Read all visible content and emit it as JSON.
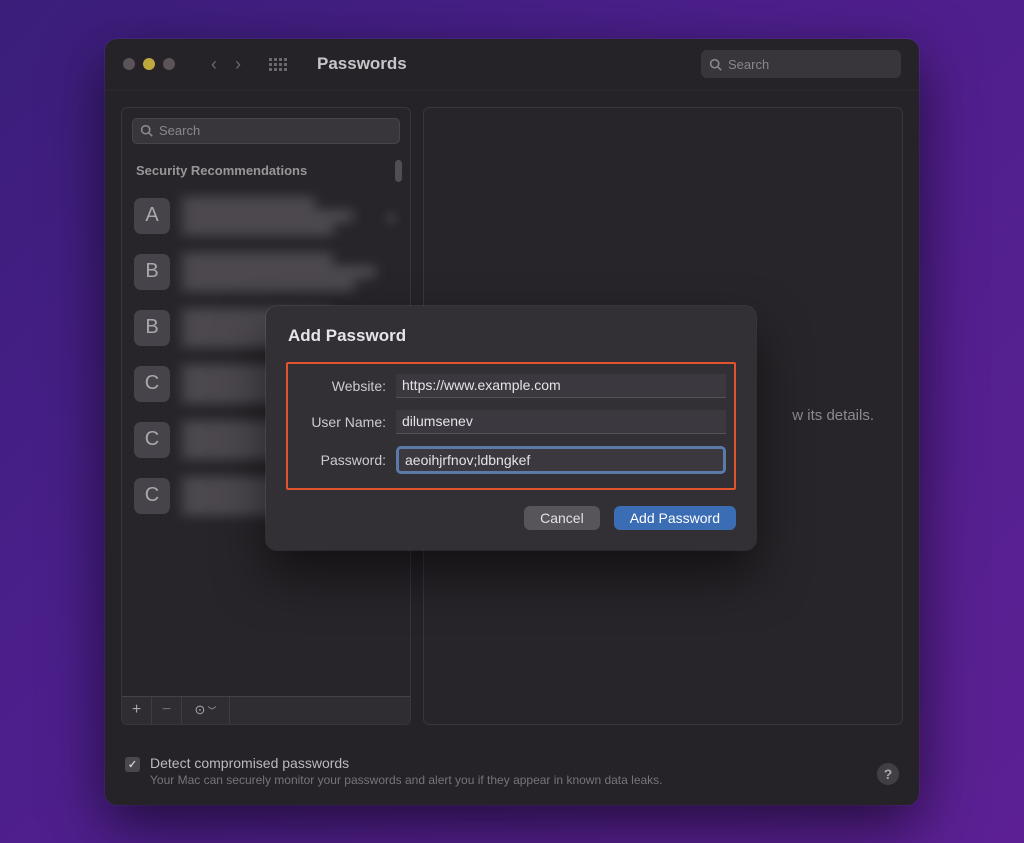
{
  "titlebar": {
    "title": "Passwords",
    "global_search_placeholder": "Search"
  },
  "sidebar": {
    "search_placeholder": "Search",
    "section_header": "Security Recommendations",
    "items": [
      {
        "letter": "A",
        "has_warning": true
      },
      {
        "letter": "B",
        "has_warning": false
      },
      {
        "letter": "B",
        "has_warning": false
      },
      {
        "letter": "C",
        "has_warning": true
      },
      {
        "letter": "C",
        "has_warning": true
      },
      {
        "letter": "C",
        "has_warning": true
      }
    ],
    "toolbar": {
      "add": "+",
      "remove": "−",
      "more": "⊙"
    }
  },
  "detail": {
    "placeholder_hint": "w its details."
  },
  "modal": {
    "title": "Add Password",
    "website_label": "Website:",
    "website_value": "https://www.example.com",
    "username_label": "User Name:",
    "username_value": "dilumsenev",
    "password_label": "Password:",
    "password_value": "aeoihjrfnov;ldbngkef",
    "cancel_label": "Cancel",
    "submit_label": "Add Password"
  },
  "footer": {
    "checkbox_checked": true,
    "title": "Detect compromised passwords",
    "description": "Your Mac can securely monitor your passwords and alert you if they appear in known data leaks."
  }
}
